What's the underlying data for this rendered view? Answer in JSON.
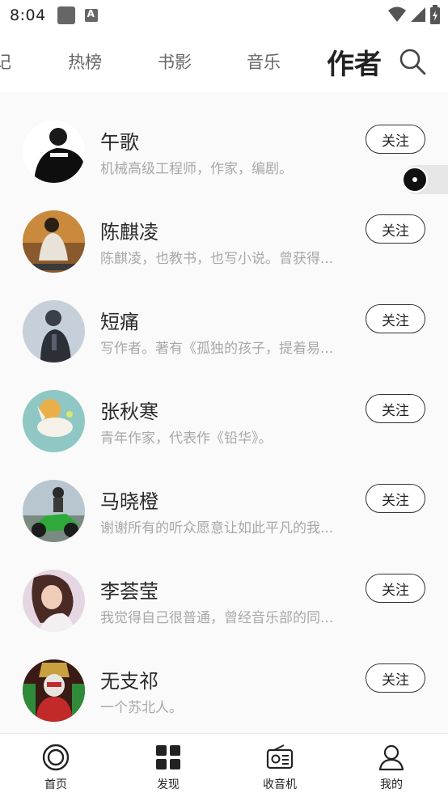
{
  "status_bar": {
    "time": "8:04"
  },
  "top_tabs": [
    {
      "label": "记"
    },
    {
      "label": "热榜"
    },
    {
      "label": "书影"
    },
    {
      "label": "音乐"
    },
    {
      "label": "作者",
      "active": true
    }
  ],
  "authors": [
    {
      "name": "午歌",
      "bio": "机械高级工程师，作家，编剧。",
      "follow_label": "关注"
    },
    {
      "name": "陈麒凌",
      "bio": "陈麒凌，也教书，也写小说。曾获得...",
      "follow_label": "关注"
    },
    {
      "name": "短痛",
      "bio": "写作者。著有《孤独的孩子，提着易...",
      "follow_label": "关注"
    },
    {
      "name": "张秋寒",
      "bio": "青年作家，代表作《铅华》。",
      "follow_label": "关注"
    },
    {
      "name": "马晓橙",
      "bio": "谢谢所有的听众愿意让如此平凡的我...",
      "follow_label": "关注"
    },
    {
      "name": "李荟莹",
      "bio": "我觉得自己很普通，曾经音乐部的同...",
      "follow_label": "关注"
    },
    {
      "name": "无支祁",
      "bio": "一个苏北人。",
      "follow_label": "关注"
    }
  ],
  "bottom_nav": [
    {
      "label": "首页",
      "icon": "home-circle-icon"
    },
    {
      "label": "发现",
      "icon": "grid-icon"
    },
    {
      "label": "收音机",
      "icon": "radio-icon"
    },
    {
      "label": "我的",
      "icon": "person-icon"
    }
  ],
  "colors": {
    "accent": "#222222",
    "bio_text": "#a8a8a8",
    "list_background": "#fafafa"
  }
}
